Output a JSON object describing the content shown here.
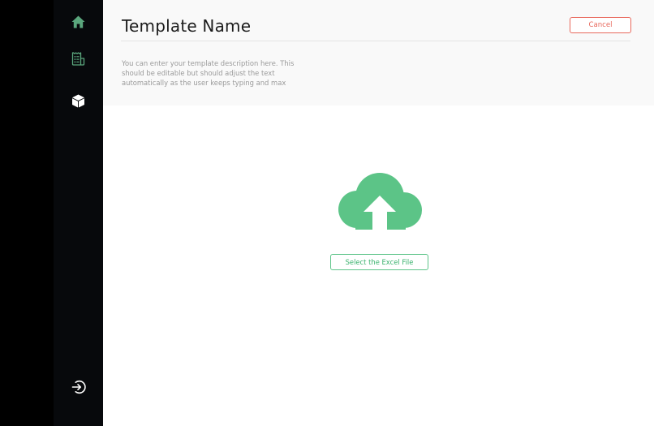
{
  "sidebar": {
    "items": [
      {
        "icon": "home-icon"
      },
      {
        "icon": "receipt-icon"
      },
      {
        "icon": "cube-icon"
      }
    ],
    "footer_icon": "logout-icon"
  },
  "header": {
    "title": "Template Name",
    "description": "You can enter your template description here. This should be editable but should adjust the text automatically as the user keeps typing and max",
    "cancel_label": "Cancel"
  },
  "upload": {
    "icon": "cloud-upload-icon",
    "button_label": "Select the Excel File"
  },
  "colors": {
    "accent": "#5cc487",
    "cancel": "#e8685c",
    "sidebar_icon": "#5aa67d",
    "sidebar_active": "#ffffff"
  }
}
